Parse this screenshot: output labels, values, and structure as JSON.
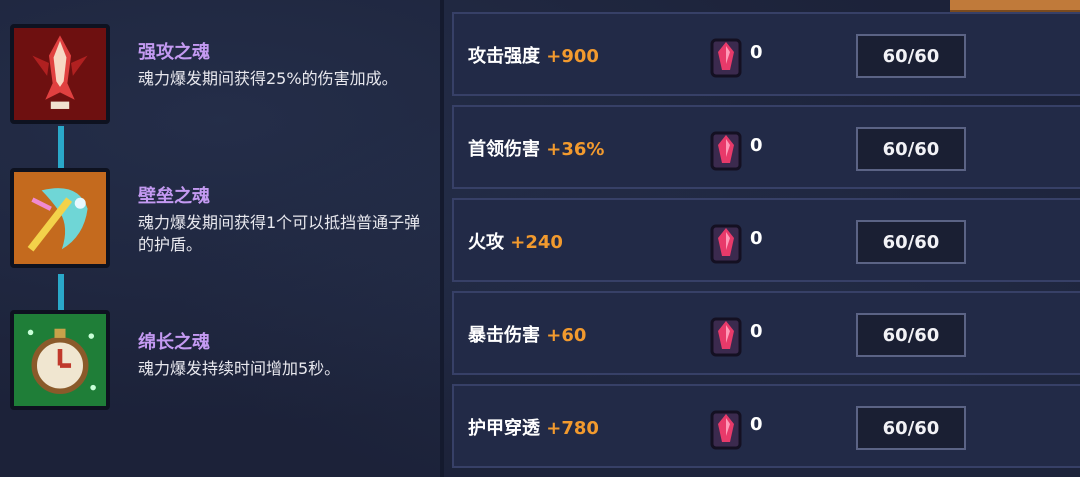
{
  "souls": [
    {
      "title": "强攻之魂",
      "desc": "魂力爆发期间获得25%的伤害加成。",
      "icon": "attack-soul-icon",
      "color": "#8b1a1a"
    },
    {
      "title": "壁垒之魂",
      "desc": "魂力爆发期间获得1个可以抵挡普通子弹的护盾。",
      "icon": "shield-soul-icon",
      "color": "#c0661c"
    },
    {
      "title": "绵长之魂",
      "desc": "魂力爆发持续时间增加5秒。",
      "icon": "stopwatch-soul-icon",
      "color": "#1e8a3a"
    }
  ],
  "stats": [
    {
      "name": "攻击强度",
      "bonus": "+900",
      "count": "0",
      "level": "60/60"
    },
    {
      "name": "首领伤害",
      "bonus": "+36%",
      "count": "0",
      "level": "60/60"
    },
    {
      "name": "火攻",
      "bonus": "+240",
      "count": "0",
      "level": "60/60"
    },
    {
      "name": "暴击伤害",
      "bonus": "+60",
      "count": "0",
      "level": "60/60"
    },
    {
      "name": "护甲穿透",
      "bonus": "+780",
      "count": "0",
      "level": "60/60"
    }
  ],
  "colors": {
    "accent": "#f29a2e",
    "soul_title": "#c49af2",
    "connector": "#2aa8c9"
  }
}
